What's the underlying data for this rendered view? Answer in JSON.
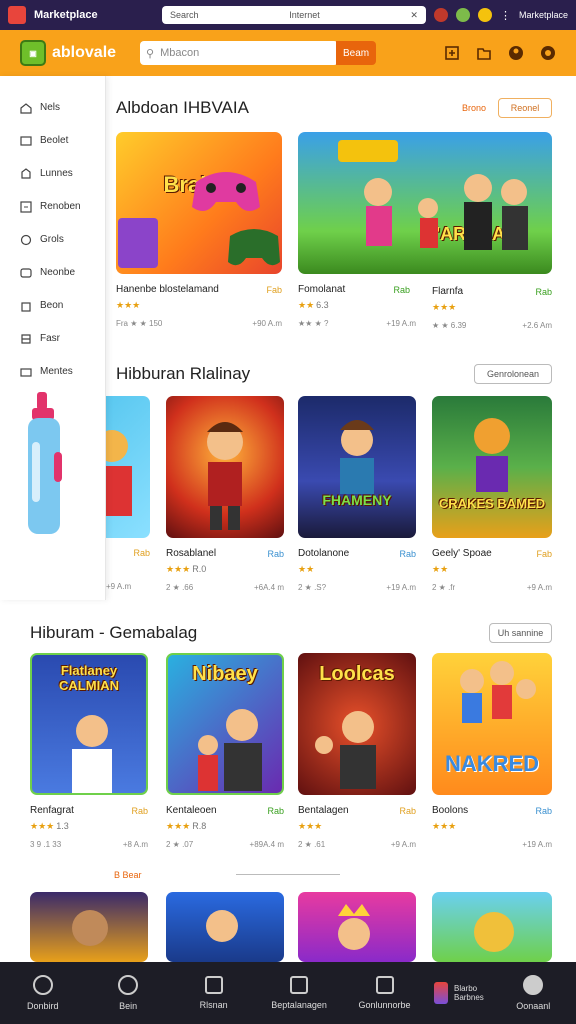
{
  "sysbar": {
    "app_title": "Marketplace",
    "url_left": "Search",
    "url_right": "Internet",
    "menu_label": "Marketplace"
  },
  "appbar": {
    "brand": "ablovale",
    "search_placeholder": "Mbacon",
    "search_button": "Beam"
  },
  "sidebar": {
    "items": [
      "Nels",
      "Beolet",
      "Lunnes",
      "Renoben",
      "Grols",
      "Neonbe",
      "Beon",
      "Fasr",
      "Mentes"
    ]
  },
  "section1": {
    "title": "Albdoan IHBVAIA",
    "see_all": "Brono",
    "button": "Reonel",
    "cards": [
      {
        "name": "Hanenbe blostelamand",
        "tag": "Fab",
        "stars": "★★★",
        "rating": "",
        "meta_left": "Fra ★ ★ 150",
        "meta_right": "+90 A.m",
        "art_text": "Brairin"
      },
      {
        "name": "Fomolanat",
        "tag": "Rab",
        "stars": "★★",
        "rating": "6.3",
        "meta_left": "★★ ★ ?",
        "meta_right": "+19 A.m",
        "art_text": "L'ARHAA"
      },
      {
        "name": "Flarnfa",
        "tag": "Rab",
        "stars": "★★★",
        "rating": "",
        "meta_left": "★ ★ 6.39",
        "meta_right": "+2.6 Am",
        "art_text": ""
      }
    ]
  },
  "section2": {
    "title": "Hibburan Rlalinay",
    "button": "Genrolonean",
    "cards": [
      {
        "name": "",
        "tag": "Rab",
        "stars": "",
        "rating": "",
        "meta_left": "+9 A.m",
        "meta_right": "",
        "art_text": ""
      },
      {
        "name": "Rosablanel",
        "tag": "Rab",
        "stars": "★★★",
        "rating": "R.0",
        "meta_left": "2 ★ .66",
        "meta_right": "+6A.4 m",
        "art_text": ""
      },
      {
        "name": "Dotolanone",
        "tag": "Rab",
        "stars": "★★",
        "rating": "",
        "meta_left": "2 ★ .S?",
        "meta_right": "+19 A.m",
        "art_text": "FHAMENY"
      },
      {
        "name": "Geely' Spoae",
        "tag": "Fab",
        "stars": "★★",
        "rating": "",
        "meta_left": "2 ★ .fr",
        "meta_right": "+9 A.m",
        "art_text": "CRAKES BAMED"
      }
    ]
  },
  "section3": {
    "title": "Hiburam - Gemabalag",
    "button": "Uh sannine",
    "divider_label": "B Bear",
    "cards": [
      {
        "name": "Renfagrat",
        "tag": "Rab",
        "stars": "★★★",
        "rating": "1.3",
        "meta_left": "3 9 .1 33",
        "meta_right": "+8 A.m",
        "art_text": "Flatlaney CALMIAN"
      },
      {
        "name": "Kentaleoen",
        "tag": "Rab",
        "stars": "★★★",
        "rating": "R.8",
        "meta_left": "2 ★ .07",
        "meta_right": "+89A.4 m",
        "art_text": "Nibaey"
      },
      {
        "name": "Bentalagen",
        "tag": "Rab",
        "stars": "★★★",
        "rating": "",
        "meta_left": "2 ★ .61",
        "meta_right": "+9 A.m",
        "art_text": "Loolcas"
      },
      {
        "name": "Boolons",
        "tag": "Rab",
        "stars": "★★★",
        "rating": "",
        "meta_left": "",
        "meta_right": "+19 A.m",
        "art_text": "NAKRED"
      }
    ]
  },
  "bottomnav": {
    "items": [
      "Donbird",
      "Bein",
      "Rlsnan",
      "Beptalanagen",
      "Gonlunnorbe",
      "Oonaanl"
    ],
    "promo_line1": "Blarbo",
    "promo_line2": "Barbnes"
  },
  "colors": {
    "accent": "#f9a21a",
    "topbar": "#2a1f4d",
    "nav": "#1d1d26"
  }
}
